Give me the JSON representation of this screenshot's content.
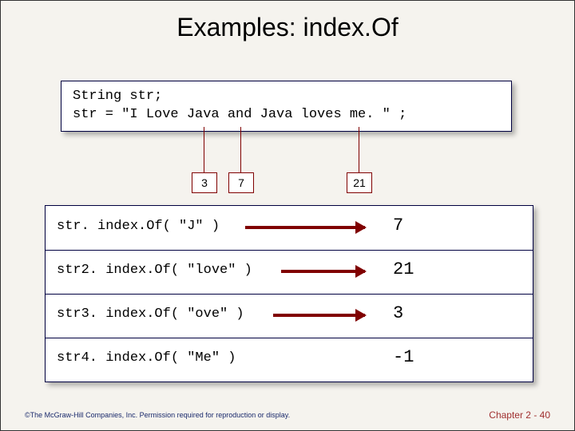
{
  "title": "Examples: index.Of",
  "code": {
    "line1": "String str;",
    "line2": "str = \"I Love Java and Java loves me. \" ;"
  },
  "pointers": {
    "p1": "3",
    "p2": "7",
    "p3": "21"
  },
  "examples": [
    {
      "code": "str. index.Of( \"J\" )",
      "result": "7"
    },
    {
      "code": "str2. index.Of( \"love\" )",
      "result": "21"
    },
    {
      "code": "str3. index.Of( \"ove\" )",
      "result": "3"
    },
    {
      "code": "str4. index.Of( \"Me\" )",
      "result": "-1"
    }
  ],
  "footer": {
    "left": "©The McGraw-Hill Companies, Inc. Permission required for reproduction or display.",
    "right": "Chapter 2 - 40"
  }
}
